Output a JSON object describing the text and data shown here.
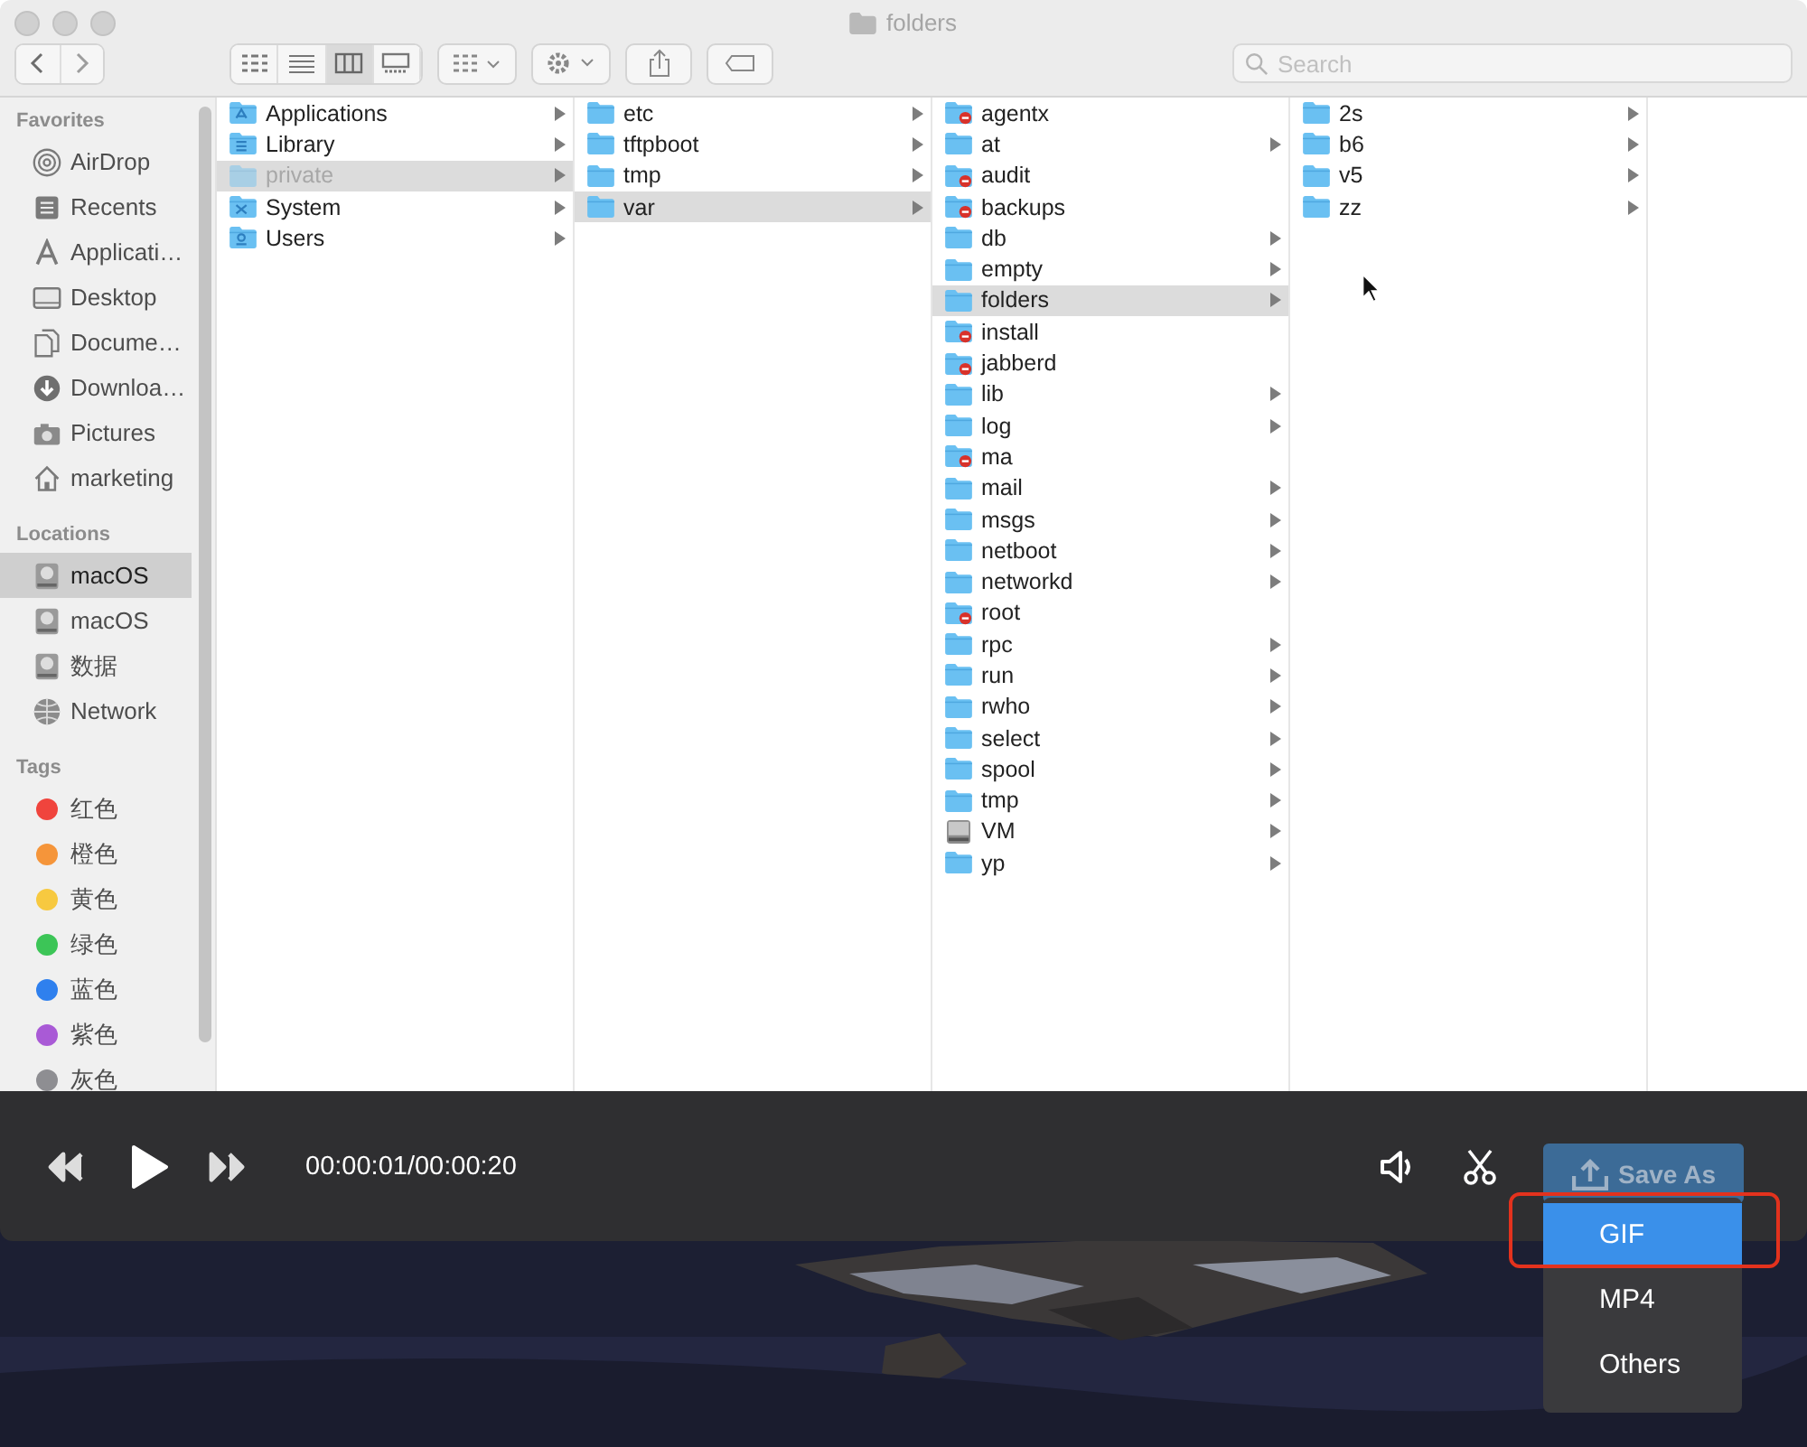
{
  "window": {
    "title": "folders"
  },
  "toolbar": {
    "view_modes": [
      {
        "kind": "icons",
        "selected": false
      },
      {
        "kind": "list",
        "selected": false
      },
      {
        "kind": "columns",
        "selected": true
      },
      {
        "kind": "gallery",
        "selected": false
      }
    ],
    "search": {
      "placeholder": "Search"
    }
  },
  "sidebar": {
    "sections": [
      {
        "title": "Favorites",
        "items": [
          {
            "label": "AirDrop",
            "kind": "airdrop",
            "selected": false
          },
          {
            "label": "Recents",
            "kind": "recents",
            "selected": false
          },
          {
            "label": "Applicati…",
            "kind": "applications",
            "selected": false
          },
          {
            "label": "Desktop",
            "kind": "desktop",
            "selected": false
          },
          {
            "label": "Docume…",
            "kind": "documents",
            "selected": false
          },
          {
            "label": "Downloa…",
            "kind": "downloads",
            "selected": false
          },
          {
            "label": "Pictures",
            "kind": "pictures",
            "selected": false
          },
          {
            "label": "marketing",
            "kind": "home",
            "selected": false
          }
        ]
      },
      {
        "title": "Locations",
        "items": [
          {
            "label": "macOS",
            "kind": "disk",
            "selected": true
          },
          {
            "label": "macOS",
            "kind": "disk",
            "selected": false
          },
          {
            "label": "数据",
            "kind": "disk",
            "selected": false
          },
          {
            "label": "Network",
            "kind": "network",
            "selected": false
          }
        ]
      },
      {
        "title": "Tags",
        "items": [
          {
            "label": "红色",
            "kind": "tag",
            "color": "#f0443d",
            "selected": false
          },
          {
            "label": "橙色",
            "kind": "tag",
            "color": "#f5953a",
            "selected": false
          },
          {
            "label": "黄色",
            "kind": "tag",
            "color": "#f7c940",
            "selected": false
          },
          {
            "label": "绿色",
            "kind": "tag",
            "color": "#3cc557",
            "selected": false
          },
          {
            "label": "蓝色",
            "kind": "tag",
            "color": "#2f80ee",
            "selected": false
          },
          {
            "label": "紫色",
            "kind": "tag",
            "color": "#a95ad6",
            "selected": false
          },
          {
            "label": "灰色",
            "kind": "tag",
            "color": "#8e8e92",
            "selected": false
          }
        ]
      }
    ]
  },
  "columns": [
    {
      "items": [
        {
          "name": "Applications",
          "kind": "applications",
          "expandable": true,
          "selected": false,
          "dimmed": false
        },
        {
          "name": "Library",
          "kind": "library",
          "expandable": true,
          "selected": false,
          "dimmed": false
        },
        {
          "name": "private",
          "kind": "folder",
          "expandable": true,
          "selected": true,
          "dimmed": true
        },
        {
          "name": "System",
          "kind": "system",
          "expandable": true,
          "selected": false,
          "dimmed": false
        },
        {
          "name": "Users",
          "kind": "users",
          "expandable": true,
          "selected": false,
          "dimmed": false
        }
      ]
    },
    {
      "items": [
        {
          "name": "etc",
          "kind": "folder",
          "expandable": true,
          "selected": false
        },
        {
          "name": "tftpboot",
          "kind": "folder",
          "expandable": true,
          "selected": false
        },
        {
          "name": "tmp",
          "kind": "folder",
          "expandable": true,
          "selected": false
        },
        {
          "name": "var",
          "kind": "folder",
          "expandable": true,
          "selected": true
        }
      ]
    },
    {
      "items": [
        {
          "name": "agentx",
          "kind": "restricted",
          "expandable": false,
          "selected": false
        },
        {
          "name": "at",
          "kind": "folder",
          "expandable": true,
          "selected": false
        },
        {
          "name": "audit",
          "kind": "restricted",
          "expandable": false,
          "selected": false
        },
        {
          "name": "backups",
          "kind": "restricted",
          "expandable": false,
          "selected": false
        },
        {
          "name": "db",
          "kind": "folder",
          "expandable": true,
          "selected": false
        },
        {
          "name": "empty",
          "kind": "folder",
          "expandable": true,
          "selected": false
        },
        {
          "name": "folders",
          "kind": "folder",
          "expandable": true,
          "selected": true
        },
        {
          "name": "install",
          "kind": "restricted",
          "expandable": false,
          "selected": false
        },
        {
          "name": "jabberd",
          "kind": "restricted",
          "expandable": false,
          "selected": false
        },
        {
          "name": "lib",
          "kind": "folder",
          "expandable": true,
          "selected": false
        },
        {
          "name": "log",
          "kind": "folder",
          "expandable": true,
          "selected": false
        },
        {
          "name": "ma",
          "kind": "restricted",
          "expandable": false,
          "selected": false
        },
        {
          "name": "mail",
          "kind": "folder",
          "expandable": true,
          "selected": false
        },
        {
          "name": "msgs",
          "kind": "folder",
          "expandable": true,
          "selected": false
        },
        {
          "name": "netboot",
          "kind": "folder",
          "expandable": true,
          "selected": false
        },
        {
          "name": "networkd",
          "kind": "folder",
          "expandable": true,
          "selected": false
        },
        {
          "name": "root",
          "kind": "restricted",
          "expandable": false,
          "selected": false
        },
        {
          "name": "rpc",
          "kind": "folder",
          "expandable": true,
          "selected": false
        },
        {
          "name": "run",
          "kind": "folder",
          "expandable": true,
          "selected": false
        },
        {
          "name": "rwho",
          "kind": "folder",
          "expandable": true,
          "selected": false
        },
        {
          "name": "select",
          "kind": "folder",
          "expandable": true,
          "selected": false
        },
        {
          "name": "spool",
          "kind": "folder",
          "expandable": true,
          "selected": false
        },
        {
          "name": "tmp",
          "kind": "folder",
          "expandable": true,
          "selected": false
        },
        {
          "name": "VM",
          "kind": "disk",
          "expandable": true,
          "selected": false
        },
        {
          "name": "yp",
          "kind": "folder",
          "expandable": true,
          "selected": false
        }
      ]
    },
    {
      "items": [
        {
          "name": "2s",
          "kind": "folder",
          "expandable": true,
          "selected": false
        },
        {
          "name": "b6",
          "kind": "folder",
          "expandable": true,
          "selected": false
        },
        {
          "name": "v5",
          "kind": "folder",
          "expandable": true,
          "selected": false
        },
        {
          "name": "zz",
          "kind": "folder",
          "expandable": true,
          "selected": false
        }
      ]
    }
  ],
  "player": {
    "time": "00:00:01/00:00:20",
    "save_button": "Save As",
    "menu": [
      {
        "label": "GIF",
        "selected": true
      },
      {
        "label": "MP4",
        "selected": false
      },
      {
        "label": "Others",
        "selected": false
      }
    ]
  }
}
